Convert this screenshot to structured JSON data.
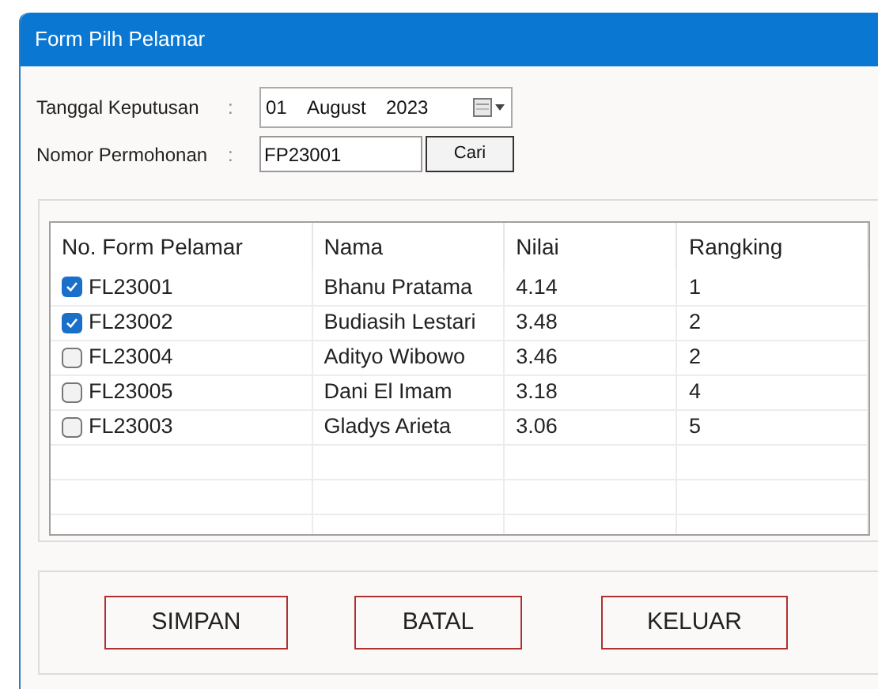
{
  "window": {
    "title": "Form Pilh Pelamar"
  },
  "fields": [
    {
      "label": "Tanggal Keputusan",
      "separator": ":",
      "kind": "date",
      "day": "01",
      "month": "August",
      "year": "2023"
    },
    {
      "label": "Nomor Permohonan",
      "separator": ":",
      "kind": "text",
      "value": "FP23001",
      "button": "Cari"
    }
  ],
  "table": {
    "columns": [
      "No. Form Pelamar",
      "Nama",
      "Nilai",
      "Rangking"
    ],
    "rows": [
      {
        "checked": true,
        "cells": [
          "FL23001",
          "Bhanu Pratama",
          "4.14",
          "1"
        ]
      },
      {
        "checked": true,
        "cells": [
          "FL23002",
          "Budiasih Lestari",
          "3.48",
          "2"
        ]
      },
      {
        "checked": false,
        "cells": [
          "FL23004",
          "Adityo Wibowo",
          "3.46",
          "2"
        ]
      },
      {
        "checked": false,
        "cells": [
          "FL23005",
          "Dani El Imam",
          "3.18",
          "4"
        ]
      },
      {
        "checked": false,
        "cells": [
          "FL23003",
          "Gladys Arieta",
          "3.06",
          "5"
        ]
      }
    ]
  },
  "buttons": [
    "SIMPAN",
    "BATAL",
    "KELUAR"
  ]
}
